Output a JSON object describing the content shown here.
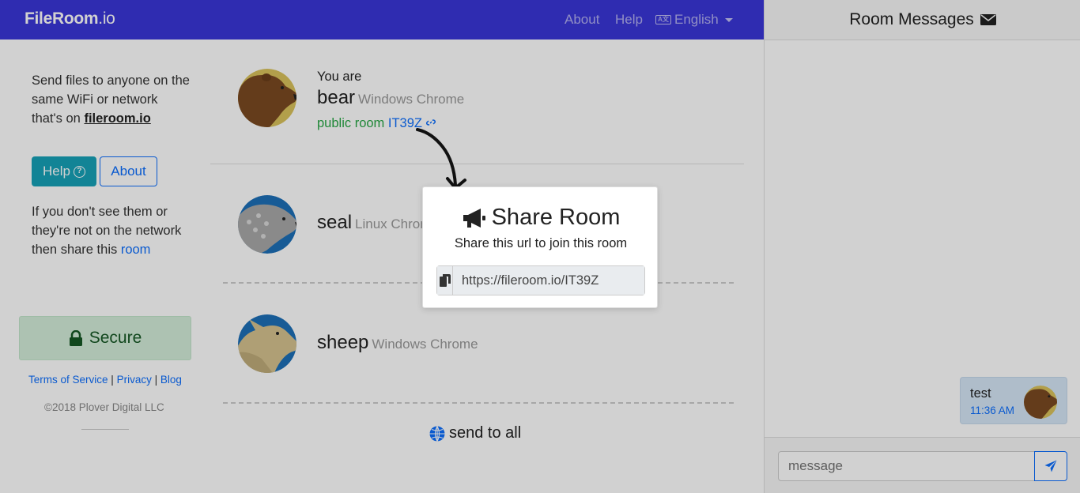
{
  "navbar": {
    "brand_name": "FileRoom",
    "brand_tld": ".io",
    "links": {
      "about": "About",
      "help": "Help",
      "language": "English"
    }
  },
  "sidebar": {
    "intro_text": "Send files to anyone on the same WiFi or network that's on",
    "intro_domain": "fileroom.io",
    "help_button": "Help",
    "about_button": "About",
    "share_hint": "If you don't see them or they're not on the network then share this",
    "share_hint_link": "room",
    "secure_label": "Secure",
    "footer": {
      "terms": "Terms of Service",
      "privacy": "Privacy",
      "blog": "Blog",
      "separator": "|"
    },
    "copyright": "©2018 Plover Digital LLC"
  },
  "self": {
    "label": "You are",
    "name": "bear",
    "device": "Windows Chrome",
    "room_prefix": "public room",
    "room_code": "IT39Z"
  },
  "peers": [
    {
      "name": "seal",
      "device": "Linux Chrome"
    },
    {
      "name": "sheep",
      "device": "Windows Chrome"
    }
  ],
  "send_all_label": "send to all",
  "chat": {
    "title": "Room Messages",
    "messages": [
      {
        "text": "test",
        "time": "11:36 AM"
      }
    ],
    "input_placeholder": "message"
  },
  "modal": {
    "title": "Share Room",
    "subtitle": "Share this url to join this room",
    "url": "https://fileroom.io/IT39Z"
  },
  "colors": {
    "navbar": "#3a36d8",
    "help_button": "#17a2b8",
    "link": "#0d6efd",
    "secure_bg": "#d4edda",
    "secure_text": "#155724",
    "room_text": "#28a745"
  }
}
